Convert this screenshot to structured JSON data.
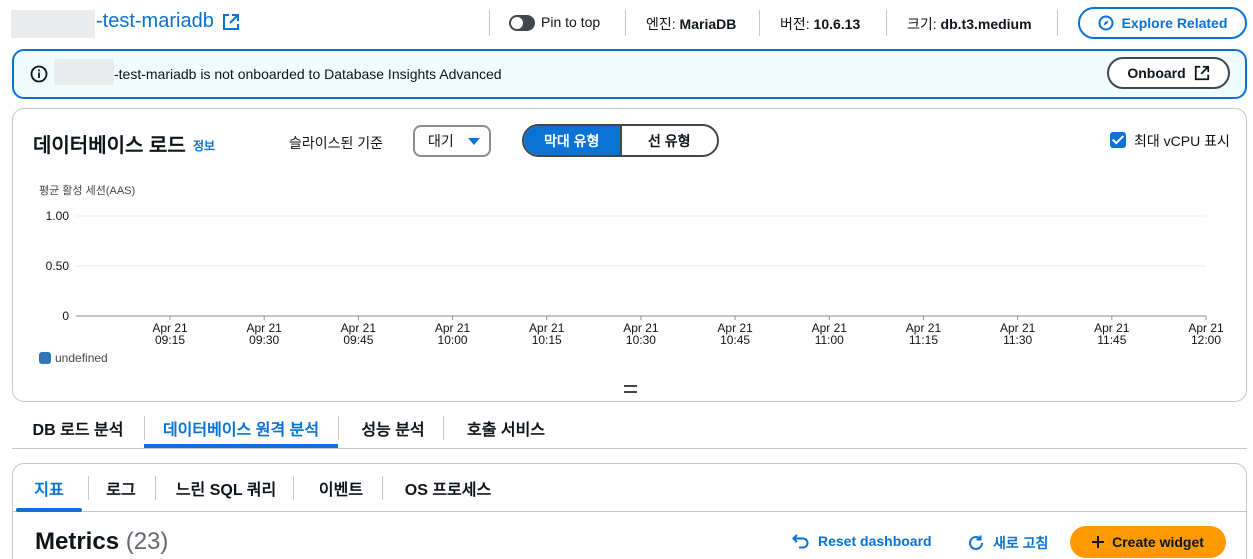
{
  "header": {
    "instance_name": "-test-mariadb",
    "pin_label": "Pin to top",
    "engine_label": "엔진:",
    "engine_value": "MariaDB",
    "version_label": "버전:",
    "version_value": "10.6.13",
    "size_label": "크기:",
    "size_value": "db.t3.medium",
    "explore_label": "Explore Related"
  },
  "banner": {
    "message": "-test-mariadb is not onboarded to Database Insights Advanced",
    "onboard_label": "Onboard"
  },
  "db_load": {
    "title": "데이터베이스 로드",
    "info_link": "정보",
    "sliced_label": "슬라이스된 기준",
    "slice_value": "대기",
    "seg_bar": "막대 유형",
    "seg_line": "선 유형",
    "vcpu_label": "최대 vCPU 표시"
  },
  "chart_data": {
    "type": "bar",
    "ylabel": "평균 활성 세션(AAS)",
    "ylim": [
      0,
      1
    ],
    "y_ticks": [
      "1.00",
      "0.50",
      "0"
    ],
    "x_ticks": [
      [
        "Apr 21",
        "09:15"
      ],
      [
        "Apr 21",
        "09:30"
      ],
      [
        "Apr 21",
        "09:45"
      ],
      [
        "Apr 21",
        "10:00"
      ],
      [
        "Apr 21",
        "10:15"
      ],
      [
        "Apr 21",
        "10:30"
      ],
      [
        "Apr 21",
        "10:45"
      ],
      [
        "Apr 21",
        "11:00"
      ],
      [
        "Apr 21",
        "11:15"
      ],
      [
        "Apr 21",
        "11:30"
      ],
      [
        "Apr 21",
        "11:45"
      ],
      [
        "Apr 21",
        "12:00"
      ]
    ],
    "series": [
      {
        "name": "undefined",
        "values": []
      }
    ],
    "grid": true,
    "legend_position": "bottom-left",
    "series_color": "#2f77b4"
  },
  "main_tabs": [
    "DB 로드 분석",
    "데이터베이스 원격 분석",
    "성능 분석",
    "호출 서비스"
  ],
  "sub_tabs": [
    "지표",
    "로그",
    "느린 SQL 쿼리",
    "이벤트",
    "OS 프로세스"
  ],
  "metrics": {
    "title": "Metrics",
    "count": "(23)",
    "reset_label": "Reset dashboard",
    "refresh_label": "새로 고침",
    "create_label": "Create widget"
  },
  "colors": {
    "accent": "#0972d3",
    "primary_button": "#ff9900",
    "banner_bg": "#f0fbff"
  }
}
